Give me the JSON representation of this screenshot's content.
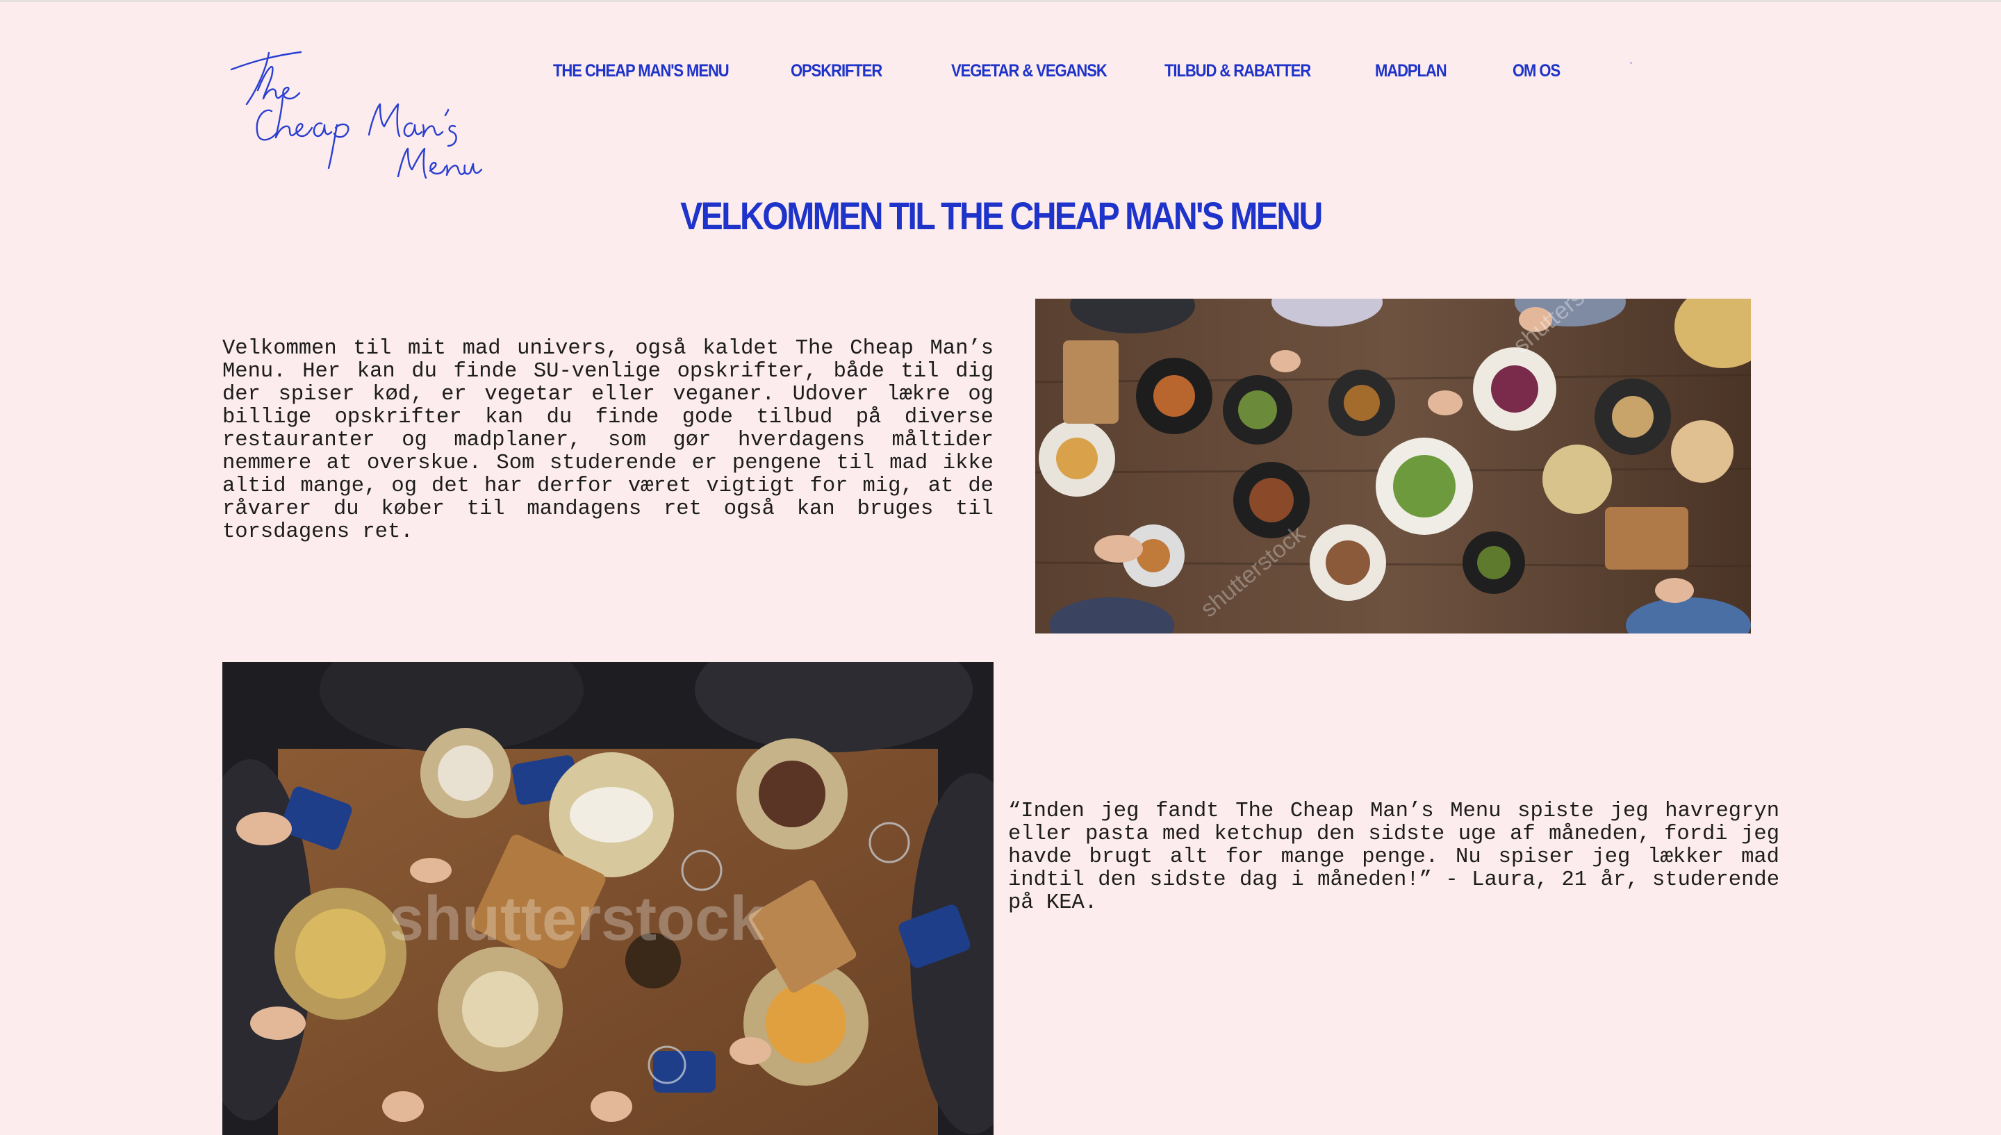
{
  "logo": {
    "lines": [
      "The",
      "Cheap",
      "Man's",
      "Menu"
    ]
  },
  "nav": {
    "items": [
      {
        "label": "THE CHEAP MAN'S MENU"
      },
      {
        "label": "OPSKRIFTER"
      },
      {
        "label": "VEGETAR & VEGANSK"
      },
      {
        "label": "TILBUD & RABATTER"
      },
      {
        "label": "MADPLAN"
      },
      {
        "label": "OM OS"
      }
    ]
  },
  "headline": "VELKOMMEN TIL THE CHEAP MAN'S MENU",
  "intro_text": "Velkommen til mit mad univers, også kaldet The Cheap Man’s Menu. Her kan du finde SU-venlige opskrifter, både til dig der spiser kød, er vegetar eller veganer. Udover lækre og billige opskrifter kan du finde gode tilbud på diverse restauranter og madplaner, som gør hverdagens måltider nemmere at overskue. Som studerende er pengene til mad ikke altid mange, og det har derfor været vigtigt for mig, at de råvarer du køber til mandagens ret også kan bruges til torsdagens ret.",
  "quote_text": "“Inden jeg fandt The Cheap Man’s Menu spiste jeg havregryn eller pasta med ketchup den sidste uge af måneden, fordi jeg havde brugt alt for mange penge. Nu spiser jeg lækker mad indtil den sidste dag i måneden!” - Laura, 21 år, studerende på KEA.",
  "images": {
    "photo1_watermark": "shutterstock",
    "photo2_watermark": "shutterstock"
  },
  "colors": {
    "background": "#fdeced",
    "brand_blue": "#1d33c9",
    "text": "#1c1c1c"
  }
}
